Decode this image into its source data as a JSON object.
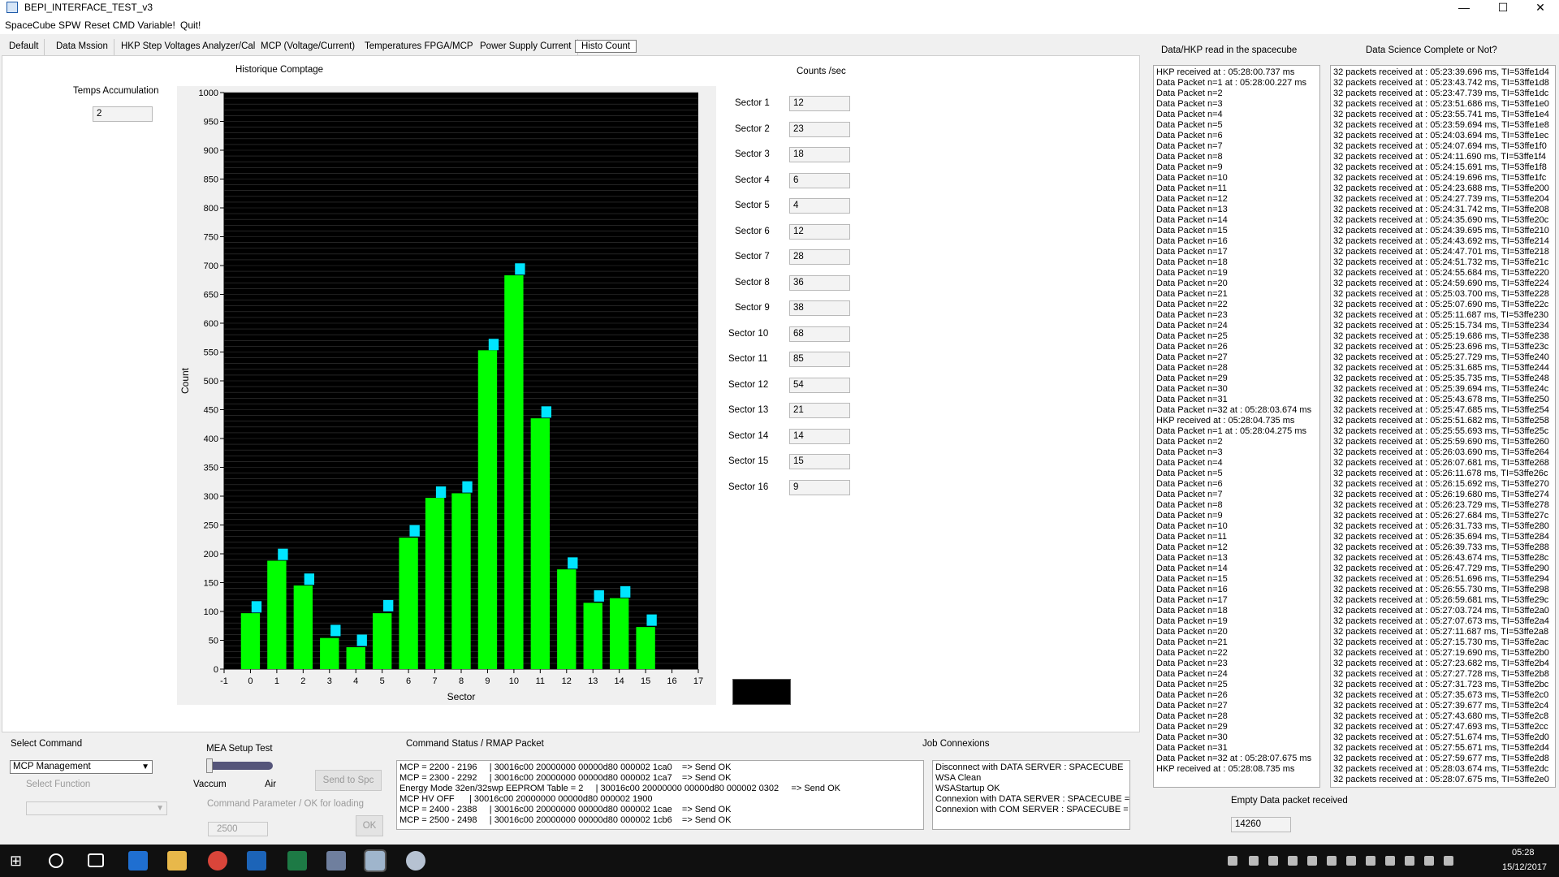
{
  "window": {
    "title": "BEPI_INTERFACE_TEST_v3",
    "minimize": "—",
    "maximize": "☐",
    "close": "✕"
  },
  "menu": [
    "SpaceCube SPW",
    "Reset CMD Variable!",
    "Quit!"
  ],
  "tabs": [
    "Default",
    "Data Mssion",
    "HKP Step Voltages Analyzer/Cal",
    "MCP (Voltage/Current)",
    "Temperatures FPGA/MCP",
    "Power Supply Current",
    "Histo Count"
  ],
  "active_tab": 6,
  "accumulation": {
    "label": "Temps Accumulation",
    "value": "2"
  },
  "counts": {
    "title": "Counts /sec",
    "sectors": [
      {
        "label": "Sector 1",
        "value": "12"
      },
      {
        "label": "Sector 2",
        "value": "23"
      },
      {
        "label": "Sector 3",
        "value": "18"
      },
      {
        "label": "Sector 4",
        "value": "6"
      },
      {
        "label": "Sector 5",
        "value": "4"
      },
      {
        "label": "Sector 6",
        "value": "12"
      },
      {
        "label": "Sector 7",
        "value": "28"
      },
      {
        "label": "Sector 8",
        "value": "36"
      },
      {
        "label": "Sector 9",
        "value": "38"
      },
      {
        "label": "Sector 10",
        "value": "68"
      },
      {
        "label": "Sector 11",
        "value": "85"
      },
      {
        "label": "Sector 12",
        "value": "54"
      },
      {
        "label": "Sector 13",
        "value": "21"
      },
      {
        "label": "Sector 14",
        "value": "14"
      },
      {
        "label": "Sector 15",
        "value": "15"
      },
      {
        "label": "Sector 16",
        "value": "9"
      }
    ]
  },
  "chart_data": {
    "type": "bar",
    "title": "Historique Comptage",
    "xlabel": "Sector",
    "ylabel": "Count",
    "xlim": [
      -1,
      17
    ],
    "ylim": [
      0,
      1000
    ],
    "x_ticks": [
      -1,
      0,
      1,
      2,
      3,
      4,
      5,
      6,
      7,
      8,
      9,
      10,
      11,
      12,
      13,
      14,
      15,
      16,
      17
    ],
    "y_ticks": [
      0,
      50,
      100,
      150,
      200,
      250,
      300,
      350,
      400,
      450,
      500,
      550,
      600,
      650,
      700,
      750,
      800,
      850,
      900,
      950,
      1000
    ],
    "bar_color": "#00ff00",
    "marker_color": "#00e5ff",
    "plot_background": "#000000",
    "series": [
      {
        "x": [
          0,
          1,
          2,
          3,
          4,
          5,
          6,
          7,
          8,
          9,
          10,
          11,
          12,
          13,
          14,
          15
        ],
        "values": [
          97,
          188,
          145,
          54,
          38,
          97,
          228,
          297,
          305,
          553,
          683,
          435,
          173,
          115,
          123,
          73
        ]
      },
      {
        "x": [
          0,
          1,
          2,
          3,
          4,
          5,
          6,
          7,
          8,
          9,
          10,
          11,
          12,
          13,
          14,
          15
        ],
        "values": [
          108,
          199,
          156,
          67,
          50,
          110,
          240,
          307,
          316,
          563,
          694,
          446,
          184,
          127,
          134,
          85
        ]
      }
    ]
  },
  "right": {
    "hkp_title": "Data/HKP read in the spacecube",
    "hkp_log": [
      "HKP received at : 05:28:00.737 ms",
      "Data Packet n=1 at : 05:28:00.227 ms",
      "Data Packet n=2",
      "Data Packet n=3",
      "Data Packet n=4",
      "Data Packet n=5",
      "Data Packet n=6",
      "Data Packet n=7",
      "Data Packet n=8",
      "Data Packet n=9",
      "Data Packet n=10",
      "Data Packet n=11",
      "Data Packet n=12",
      "Data Packet n=13",
      "Data Packet n=14",
      "Data Packet n=15",
      "Data Packet n=16",
      "Data Packet n=17",
      "Data Packet n=18",
      "Data Packet n=19",
      "Data Packet n=20",
      "Data Packet n=21",
      "Data Packet n=22",
      "Data Packet n=23",
      "Data Packet n=24",
      "Data Packet n=25",
      "Data Packet n=26",
      "Data Packet n=27",
      "Data Packet n=28",
      "Data Packet n=29",
      "Data Packet n=30",
      "Data Packet n=31",
      "Data Packet n=32 at : 05:28:03.674 ms",
      "HKP received at : 05:28:04.735 ms",
      "Data Packet n=1 at : 05:28:04.275 ms",
      "Data Packet n=2",
      "Data Packet n=3",
      "Data Packet n=4",
      "Data Packet n=5",
      "Data Packet n=6",
      "Data Packet n=7",
      "Data Packet n=8",
      "Data Packet n=9",
      "Data Packet n=10",
      "Data Packet n=11",
      "Data Packet n=12",
      "Data Packet n=13",
      "Data Packet n=14",
      "Data Packet n=15",
      "Data Packet n=16",
      "Data Packet n=17",
      "Data Packet n=18",
      "Data Packet n=19",
      "Data Packet n=20",
      "Data Packet n=21",
      "Data Packet n=22",
      "Data Packet n=23",
      "Data Packet n=24",
      "Data Packet n=25",
      "Data Packet n=26",
      "Data Packet n=27",
      "Data Packet n=28",
      "Data Packet n=29",
      "Data Packet n=30",
      "Data Packet n=31",
      "Data Packet n=32 at : 05:28:07.675 ms",
      "HKP received at : 05:28:08.735 ms"
    ],
    "science_title": "Data Science Complete or Not?",
    "science_log": [
      "32 packets received at : 05:23:39.696 ms, TI=53ffe1d4",
      "32 packets received at : 05:23:43.742 ms, TI=53ffe1d8",
      "32 packets received at : 05:23:47.739 ms, TI=53ffe1dc",
      "32 packets received at : 05:23:51.686 ms, TI=53ffe1e0",
      "32 packets received at : 05:23:55.741 ms, TI=53ffe1e4",
      "32 packets received at : 05:23:59.694 ms, TI=53ffe1e8",
      "32 packets received at : 05:24:03.694 ms, TI=53ffe1ec",
      "32 packets received at : 05:24:07.694 ms, TI=53ffe1f0",
      "32 packets received at : 05:24:11.690 ms, TI=53ffe1f4",
      "32 packets received at : 05:24:15.691 ms, TI=53ffe1f8",
      "32 packets received at : 05:24:19.696 ms, TI=53ffe1fc",
      "32 packets received at : 05:24:23.688 ms, TI=53ffe200",
      "32 packets received at : 05:24:27.739 ms, TI=53ffe204",
      "32 packets received at : 05:24:31.742 ms, TI=53ffe208",
      "32 packets received at : 05:24:35.690 ms, TI=53ffe20c",
      "32 packets received at : 05:24:39.695 ms, TI=53ffe210",
      "32 packets received at : 05:24:43.692 ms, TI=53ffe214",
      "32 packets received at : 05:24:47.701 ms, TI=53ffe218",
      "32 packets received at : 05:24:51.732 ms, TI=53ffe21c",
      "32 packets received at : 05:24:55.684 ms, TI=53ffe220",
      "32 packets received at : 05:24:59.690 ms, TI=53ffe224",
      "32 packets received at : 05:25:03.700 ms, TI=53ffe228",
      "32 packets received at : 05:25:07.690 ms, TI=53ffe22c",
      "32 packets received at : 05:25:11.687 ms, TI=53ffe230",
      "32 packets received at : 05:25:15.734 ms, TI=53ffe234",
      "32 packets received at : 05:25:19.686 ms, TI=53ffe238",
      "32 packets received at : 05:25:23.696 ms, TI=53ffe23c",
      "32 packets received at : 05:25:27.729 ms, TI=53ffe240",
      "32 packets received at : 05:25:31.685 ms, TI=53ffe244",
      "32 packets received at : 05:25:35.735 ms, TI=53ffe248",
      "32 packets received at : 05:25:39.694 ms, TI=53ffe24c",
      "32 packets received at : 05:25:43.678 ms, TI=53ffe250",
      "32 packets received at : 05:25:47.685 ms, TI=53ffe254",
      "32 packets received at : 05:25:51.682 ms, TI=53ffe258",
      "32 packets received at : 05:25:55.693 ms, TI=53ffe25c",
      "32 packets received at : 05:25:59.690 ms, TI=53ffe260",
      "32 packets received at : 05:26:03.690 ms, TI=53ffe264",
      "32 packets received at : 05:26:07.681 ms, TI=53ffe268",
      "32 packets received at : 05:26:11.678 ms, TI=53ffe26c",
      "32 packets received at : 05:26:15.692 ms, TI=53ffe270",
      "32 packets received at : 05:26:19.680 ms, TI=53ffe274",
      "32 packets received at : 05:26:23.729 ms, TI=53ffe278",
      "32 packets received at : 05:26:27.684 ms, TI=53ffe27c",
      "32 packets received at : 05:26:31.733 ms, TI=53ffe280",
      "32 packets received at : 05:26:35.694 ms, TI=53ffe284",
      "32 packets received at : 05:26:39.733 ms, TI=53ffe288",
      "32 packets received at : 05:26:43.674 ms, TI=53ffe28c",
      "32 packets received at : 05:26:47.729 ms, TI=53ffe290",
      "32 packets received at : 05:26:51.696 ms, TI=53ffe294",
      "32 packets received at : 05:26:55.730 ms, TI=53ffe298",
      "32 packets received at : 05:26:59.681 ms, TI=53ffe29c",
      "32 packets received at : 05:27:03.724 ms, TI=53ffe2a0",
      "32 packets received at : 05:27:07.673 ms, TI=53ffe2a4",
      "32 packets received at : 05:27:11.687 ms, TI=53ffe2a8",
      "32 packets received at : 05:27:15.730 ms, TI=53ffe2ac",
      "32 packets received at : 05:27:19.690 ms, TI=53ffe2b0",
      "32 packets received at : 05:27:23.682 ms, TI=53ffe2b4",
      "32 packets received at : 05:27:27.728 ms, TI=53ffe2b8",
      "32 packets received at : 05:27:31.723 ms, TI=53ffe2bc",
      "32 packets received at : 05:27:35.673 ms, TI=53ffe2c0",
      "32 packets received at : 05:27:39.677 ms, TI=53ffe2c4",
      "32 packets received at : 05:27:43.680 ms, TI=53ffe2c8",
      "32 packets received at : 05:27:47.693 ms, TI=53ffe2cc",
      "32 packets received at : 05:27:51.674 ms, TI=53ffe2d0",
      "32 packets received at : 05:27:55.671 ms, TI=53ffe2d4",
      "32 packets received at : 05:27:59.677 ms, TI=53ffe2d8",
      "32 packets received at : 05:28:03.674 ms, TI=53ffe2dc",
      "32 packets received at : 05:28:07.675 ms, TI=53ffe2e0"
    ],
    "empty_label": "Empty Data packet received",
    "empty_value": "14260"
  },
  "bottom": {
    "select_command_label": "Select Command",
    "select_command_value": "MCP Management",
    "select_function_label": "Select Function",
    "select_function_value": "",
    "mea_label": "MEA Setup Test",
    "vaccum": "Vaccum",
    "air": "Air",
    "send_button": "Send to Spc",
    "param_label": "Command Parameter / OK for loading",
    "param_value": "2500",
    "ok_button": "OK",
    "status_title": "Command Status / RMAP Packet",
    "status_log": [
      "MCP = 2200 - 2196     | 30016c00 20000000 00000d80 000002 1ca0    => Send OK",
      "MCP = 2300 - 2292     | 30016c00 20000000 00000d80 000002 1ca7    => Send OK",
      "Energy Mode 32en/32swp EEPROM Table = 2     | 30016c00 20000000 00000d80 000002 0302     => Send OK",
      "MCP HV OFF      | 30016c00 20000000 00000d80 000002 1900",
      "MCP = 2400 - 2388     | 30016c00 20000000 00000d80 000002 1cae    => Send OK",
      "MCP = 2500 - 2498     | 30016c00 20000000 00000d80 000002 1cb6    => Send OK"
    ],
    "job_title": "Job Connexions",
    "job_log": [
      "Disconnect with DATA SERVER : SPACECUBE",
      "WSA Clean",
      "WSAStartup OK",
      "Connexion with DATA SERVER : SPACECUBE = (",
      "Connexion with COM SERVER : SPACECUBE = O"
    ]
  },
  "taskbar": {
    "time": "05:28",
    "date": "15/12/2017"
  }
}
